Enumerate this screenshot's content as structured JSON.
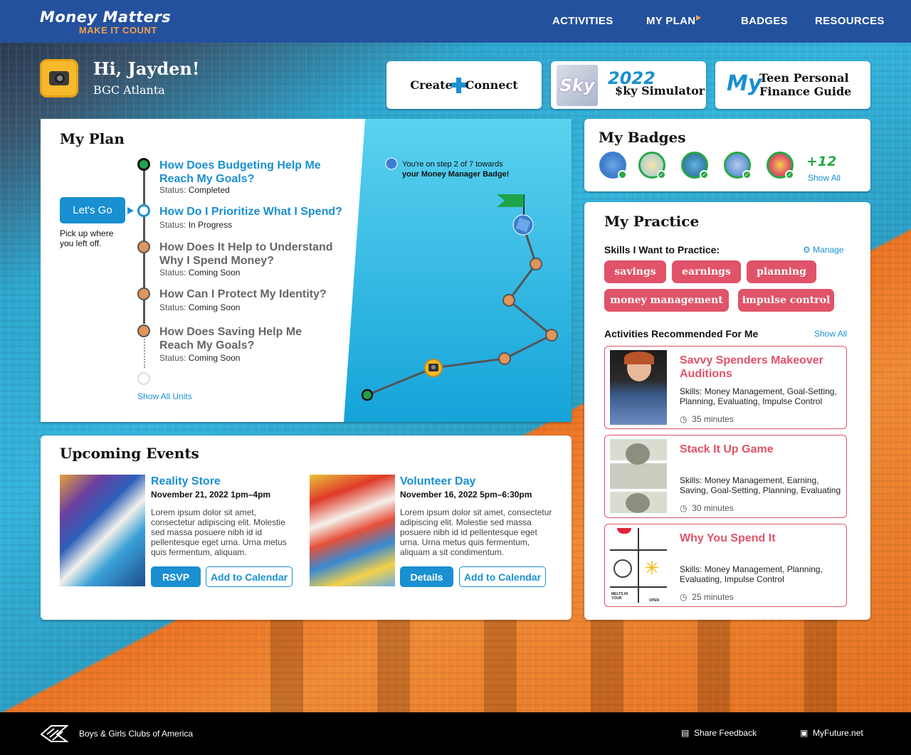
{
  "header": {
    "logo_title": "Money Matters",
    "logo_tagline": "MAKE IT COUNT",
    "nav": [
      "ACTIVITIES",
      "MY PLAN",
      "BADGES",
      "RESOURCES"
    ]
  },
  "user": {
    "greeting": "Hi, Jayden!",
    "club": "BGC Atlanta"
  },
  "promos": {
    "create_connect": {
      "left": "Create",
      "right": "Connect"
    },
    "sky": {
      "year": "2022",
      "label": "$ky Simulator",
      "thumb": "Sky"
    },
    "guide": {
      "my": "My",
      "line1": "Teen Personal",
      "line2": "Finance Guide"
    }
  },
  "plan": {
    "title": "My Plan",
    "lets_go": "Let's Go",
    "pick_up": "Pick up where you left off.",
    "show_all_units": "Show All Units",
    "status_label": "Status:",
    "units": [
      {
        "title": "How Does Budgeting Help Me Reach My Goals?",
        "status": "Completed"
      },
      {
        "title": "How Do I Prioritize What I Spend?",
        "status": "In Progress"
      },
      {
        "title": "How Does It Help to Understand Why I Spend Money?",
        "status": "Coming Soon"
      },
      {
        "title": "How Can I Protect My Identity?",
        "status": "Coming Soon"
      },
      {
        "title": "How Does Saving Help Me Reach My Goals?",
        "status": "Coming Soon"
      }
    ],
    "progress_text": "You're on step 2 of 7 towards",
    "progress_badge": "your Money Manager Badge!",
    "progress_step": 2,
    "progress_total": 7
  },
  "badges": {
    "title": "My Badges",
    "more": "+12",
    "show_all": "Show All"
  },
  "practice": {
    "title": "My Practice",
    "skills_heading": "Skills I Want to Practice:",
    "manage": "Manage",
    "skills": [
      "savings",
      "earnings",
      "planning",
      "money management",
      "impulse control"
    ],
    "recommended_heading": "Activities Recommended For Me",
    "show_all": "Show All",
    "skills_label": "Skills:",
    "activities": [
      {
        "title": "Savvy Spenders Makeover Auditions",
        "skills": "Money Management, Goal-Setting, Planning, Evaluating, Impulse Control",
        "duration": "35 minutes"
      },
      {
        "title": "Stack It Up Game",
        "skills": "Money Management, Earning, Saving, Goal-Setting, Planning, Evaluating",
        "duration": "30 minutes"
      },
      {
        "title": "Why You Spend It",
        "skills": "Money Management, Planning, Evaluating, Impulse Control",
        "duration": "25 minutes",
        "thumb_text_1": "MELTS IN YOUR",
        "thumb_text_2": "OPEN"
      }
    ]
  },
  "events": {
    "title": "Upcoming Events",
    "items": [
      {
        "title": "Reality Store",
        "date": "November 21, 2022 1pm–4pm",
        "desc": "Lorem ipsum dolor sit amet, consectetur adipiscing elit. Molestie sed massa posuere nibh id id pellentesque eget urna. Urna metus quis fermentum, aliquam.",
        "primary": "RSVP",
        "secondary": "Add to Calendar"
      },
      {
        "title": "Volunteer Day",
        "date": "November 16, 2022 5pm–6:30pm",
        "desc": "Lorem ipsum dolor sit amet, consectetur adipiscing elit. Molestie sed massa posuere nibh id id pellentesque eget urna. Urna metus quis fermentum, aliquam a sit condimentum.",
        "primary": "Details",
        "secondary": "Add to Calendar"
      }
    ]
  },
  "footer": {
    "org": "Boys & Girls Clubs of America",
    "feedback": "Share Feedback",
    "myfuture": "MyFuture.net"
  },
  "colors": {
    "brand_blue": "#24519e",
    "accent_blue": "#1a8fd1",
    "accent_red": "#e05368",
    "badge_green": "#27a844",
    "node_orange": "#e0955a"
  }
}
